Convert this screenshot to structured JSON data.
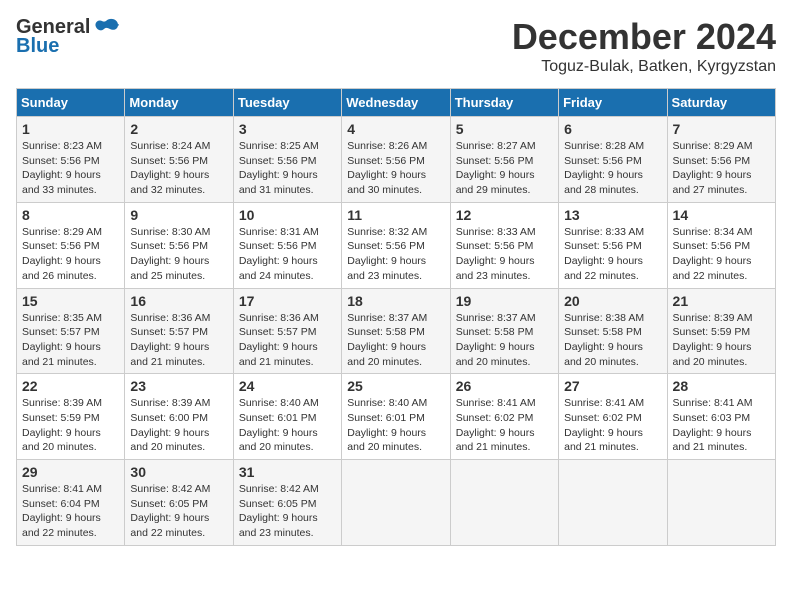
{
  "logo": {
    "general": "General",
    "blue": "Blue"
  },
  "header": {
    "month": "December 2024",
    "location": "Toguz-Bulak, Batken, Kyrgyzstan"
  },
  "days_of_week": [
    "Sunday",
    "Monday",
    "Tuesday",
    "Wednesday",
    "Thursday",
    "Friday",
    "Saturday"
  ],
  "weeks": [
    [
      {
        "day": "1",
        "sunrise": "Sunrise: 8:23 AM",
        "sunset": "Sunset: 5:56 PM",
        "daylight": "Daylight: 9 hours and 33 minutes."
      },
      {
        "day": "2",
        "sunrise": "Sunrise: 8:24 AM",
        "sunset": "Sunset: 5:56 PM",
        "daylight": "Daylight: 9 hours and 32 minutes."
      },
      {
        "day": "3",
        "sunrise": "Sunrise: 8:25 AM",
        "sunset": "Sunset: 5:56 PM",
        "daylight": "Daylight: 9 hours and 31 minutes."
      },
      {
        "day": "4",
        "sunrise": "Sunrise: 8:26 AM",
        "sunset": "Sunset: 5:56 PM",
        "daylight": "Daylight: 9 hours and 30 minutes."
      },
      {
        "day": "5",
        "sunrise": "Sunrise: 8:27 AM",
        "sunset": "Sunset: 5:56 PM",
        "daylight": "Daylight: 9 hours and 29 minutes."
      },
      {
        "day": "6",
        "sunrise": "Sunrise: 8:28 AM",
        "sunset": "Sunset: 5:56 PM",
        "daylight": "Daylight: 9 hours and 28 minutes."
      },
      {
        "day": "7",
        "sunrise": "Sunrise: 8:29 AM",
        "sunset": "Sunset: 5:56 PM",
        "daylight": "Daylight: 9 hours and 27 minutes."
      }
    ],
    [
      {
        "day": "8",
        "sunrise": "Sunrise: 8:29 AM",
        "sunset": "Sunset: 5:56 PM",
        "daylight": "Daylight: 9 hours and 26 minutes."
      },
      {
        "day": "9",
        "sunrise": "Sunrise: 8:30 AM",
        "sunset": "Sunset: 5:56 PM",
        "daylight": "Daylight: 9 hours and 25 minutes."
      },
      {
        "day": "10",
        "sunrise": "Sunrise: 8:31 AM",
        "sunset": "Sunset: 5:56 PM",
        "daylight": "Daylight: 9 hours and 24 minutes."
      },
      {
        "day": "11",
        "sunrise": "Sunrise: 8:32 AM",
        "sunset": "Sunset: 5:56 PM",
        "daylight": "Daylight: 9 hours and 23 minutes."
      },
      {
        "day": "12",
        "sunrise": "Sunrise: 8:33 AM",
        "sunset": "Sunset: 5:56 PM",
        "daylight": "Daylight: 9 hours and 23 minutes."
      },
      {
        "day": "13",
        "sunrise": "Sunrise: 8:33 AM",
        "sunset": "Sunset: 5:56 PM",
        "daylight": "Daylight: 9 hours and 22 minutes."
      },
      {
        "day": "14",
        "sunrise": "Sunrise: 8:34 AM",
        "sunset": "Sunset: 5:56 PM",
        "daylight": "Daylight: 9 hours and 22 minutes."
      }
    ],
    [
      {
        "day": "15",
        "sunrise": "Sunrise: 8:35 AM",
        "sunset": "Sunset: 5:57 PM",
        "daylight": "Daylight: 9 hours and 21 minutes."
      },
      {
        "day": "16",
        "sunrise": "Sunrise: 8:36 AM",
        "sunset": "Sunset: 5:57 PM",
        "daylight": "Daylight: 9 hours and 21 minutes."
      },
      {
        "day": "17",
        "sunrise": "Sunrise: 8:36 AM",
        "sunset": "Sunset: 5:57 PM",
        "daylight": "Daylight: 9 hours and 21 minutes."
      },
      {
        "day": "18",
        "sunrise": "Sunrise: 8:37 AM",
        "sunset": "Sunset: 5:58 PM",
        "daylight": "Daylight: 9 hours and 20 minutes."
      },
      {
        "day": "19",
        "sunrise": "Sunrise: 8:37 AM",
        "sunset": "Sunset: 5:58 PM",
        "daylight": "Daylight: 9 hours and 20 minutes."
      },
      {
        "day": "20",
        "sunrise": "Sunrise: 8:38 AM",
        "sunset": "Sunset: 5:58 PM",
        "daylight": "Daylight: 9 hours and 20 minutes."
      },
      {
        "day": "21",
        "sunrise": "Sunrise: 8:39 AM",
        "sunset": "Sunset: 5:59 PM",
        "daylight": "Daylight: 9 hours and 20 minutes."
      }
    ],
    [
      {
        "day": "22",
        "sunrise": "Sunrise: 8:39 AM",
        "sunset": "Sunset: 5:59 PM",
        "daylight": "Daylight: 9 hours and 20 minutes."
      },
      {
        "day": "23",
        "sunrise": "Sunrise: 8:39 AM",
        "sunset": "Sunset: 6:00 PM",
        "daylight": "Daylight: 9 hours and 20 minutes."
      },
      {
        "day": "24",
        "sunrise": "Sunrise: 8:40 AM",
        "sunset": "Sunset: 6:01 PM",
        "daylight": "Daylight: 9 hours and 20 minutes."
      },
      {
        "day": "25",
        "sunrise": "Sunrise: 8:40 AM",
        "sunset": "Sunset: 6:01 PM",
        "daylight": "Daylight: 9 hours and 20 minutes."
      },
      {
        "day": "26",
        "sunrise": "Sunrise: 8:41 AM",
        "sunset": "Sunset: 6:02 PM",
        "daylight": "Daylight: 9 hours and 21 minutes."
      },
      {
        "day": "27",
        "sunrise": "Sunrise: 8:41 AM",
        "sunset": "Sunset: 6:02 PM",
        "daylight": "Daylight: 9 hours and 21 minutes."
      },
      {
        "day": "28",
        "sunrise": "Sunrise: 8:41 AM",
        "sunset": "Sunset: 6:03 PM",
        "daylight": "Daylight: 9 hours and 21 minutes."
      }
    ],
    [
      {
        "day": "29",
        "sunrise": "Sunrise: 8:41 AM",
        "sunset": "Sunset: 6:04 PM",
        "daylight": "Daylight: 9 hours and 22 minutes."
      },
      {
        "day": "30",
        "sunrise": "Sunrise: 8:42 AM",
        "sunset": "Sunset: 6:05 PM",
        "daylight": "Daylight: 9 hours and 22 minutes."
      },
      {
        "day": "31",
        "sunrise": "Sunrise: 8:42 AM",
        "sunset": "Sunset: 6:05 PM",
        "daylight": "Daylight: 9 hours and 23 minutes."
      },
      null,
      null,
      null,
      null
    ]
  ]
}
